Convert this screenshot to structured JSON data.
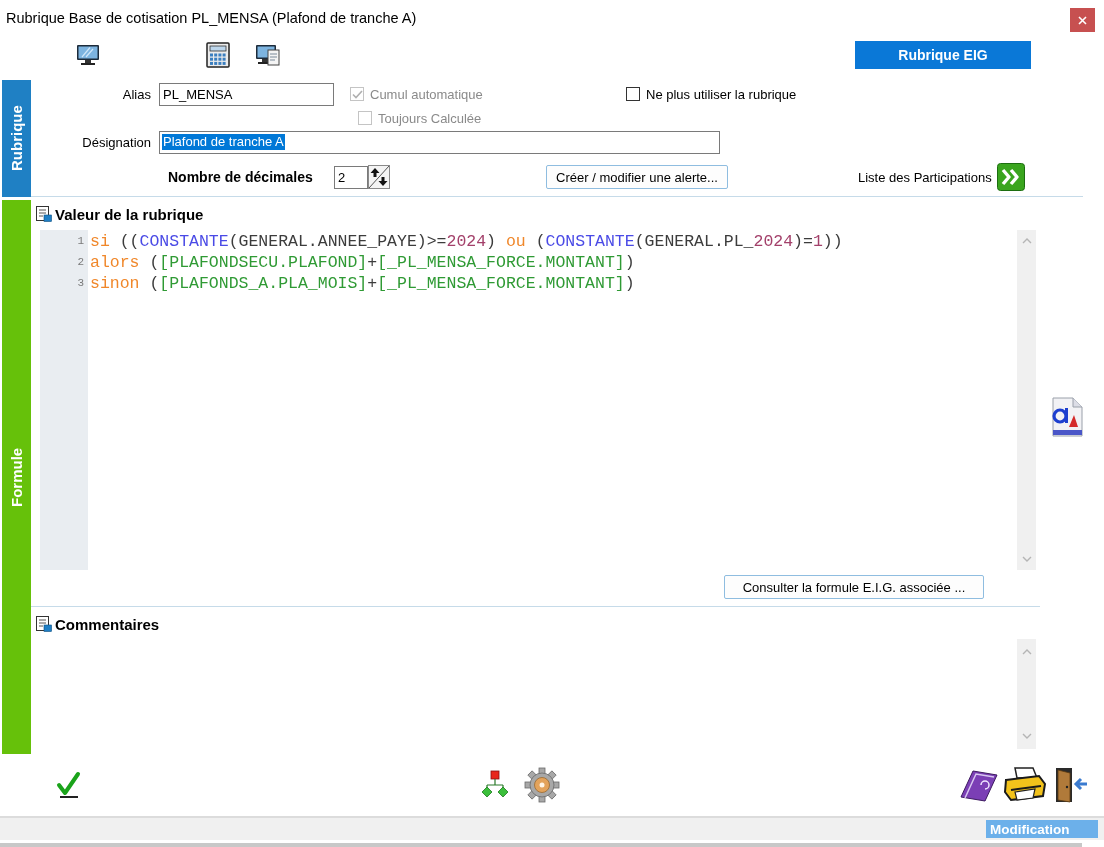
{
  "window": {
    "title": "Rubrique Base de cotisation PL_MENSA (Plafond de tranche A)"
  },
  "toolbar": {
    "eig_button": "Rubrique EIG"
  },
  "rubrique": {
    "tab": "Rubrique",
    "alias": {
      "label": "Alias",
      "value": "PL_MENSA"
    },
    "options": [
      {
        "label": "Cumul automatique",
        "checked": true,
        "disabled": true
      },
      {
        "label": "Toujours Calculée",
        "checked": false,
        "disabled": true
      }
    ],
    "retire_option": {
      "label": "Ne plus utiliser la rubrique",
      "checked": false,
      "disabled": false
    },
    "designation": {
      "label": "Désignation",
      "value": "Plafond de tranche A",
      "highlighted": true
    },
    "decimals": {
      "label": "Nombre de décimales",
      "value": "2"
    },
    "alert_button": "Créer / modifier une alerte...",
    "participations": "Liste des Participations"
  },
  "formule": {
    "tab": "Formule",
    "title": "Valeur de la rubrique",
    "code_lines": [
      {
        "number": "1",
        "tokens": [
          {
            "kind": "keyword",
            "text": "si"
          },
          {
            "kind": "plain",
            "text": " (("
          },
          {
            "kind": "function",
            "text": "CONSTANTE"
          },
          {
            "kind": "plain",
            "text": "(GENERAL.ANNEE_PAYE)>="
          },
          {
            "kind": "number",
            "text": "2024"
          },
          {
            "kind": "plain",
            "text": ") "
          },
          {
            "kind": "keyword",
            "text": "ou"
          },
          {
            "kind": "plain",
            "text": " ("
          },
          {
            "kind": "function",
            "text": "CONSTANTE"
          },
          {
            "kind": "plain",
            "text": "(GENERAL.PL_"
          },
          {
            "kind": "number",
            "text": "2024"
          },
          {
            "kind": "plain",
            "text": ")="
          },
          {
            "kind": "number",
            "text": "1"
          },
          {
            "kind": "plain",
            "text": "))"
          }
        ]
      },
      {
        "number": "2",
        "tokens": [
          {
            "kind": "keyword",
            "text": "alors"
          },
          {
            "kind": "plain",
            "text": " ("
          },
          {
            "kind": "field",
            "text": "[PLAFONDSECU.PLAFOND]"
          },
          {
            "kind": "plain",
            "text": "+"
          },
          {
            "kind": "field",
            "text": "[_PL_MENSA_FORCE.MONTANT]"
          },
          {
            "kind": "plain",
            "text": ")"
          }
        ]
      },
      {
        "number": "3",
        "tokens": [
          {
            "kind": "keyword",
            "text": "sinon"
          },
          {
            "kind": "plain",
            "text": " ("
          },
          {
            "kind": "field",
            "text": "[PLAFONDS_A.PLA_MOIS]"
          },
          {
            "kind": "plain",
            "text": "+"
          },
          {
            "kind": "field",
            "text": "[_PL_MENSA_FORCE.MONTANT]"
          },
          {
            "kind": "plain",
            "text": ")"
          }
        ]
      }
    ],
    "eig_formula_button": "Consulter la formule E.I.G. associée ...",
    "comments_title": "Commentaires"
  },
  "status_bar": {
    "mode": "Modification"
  }
}
